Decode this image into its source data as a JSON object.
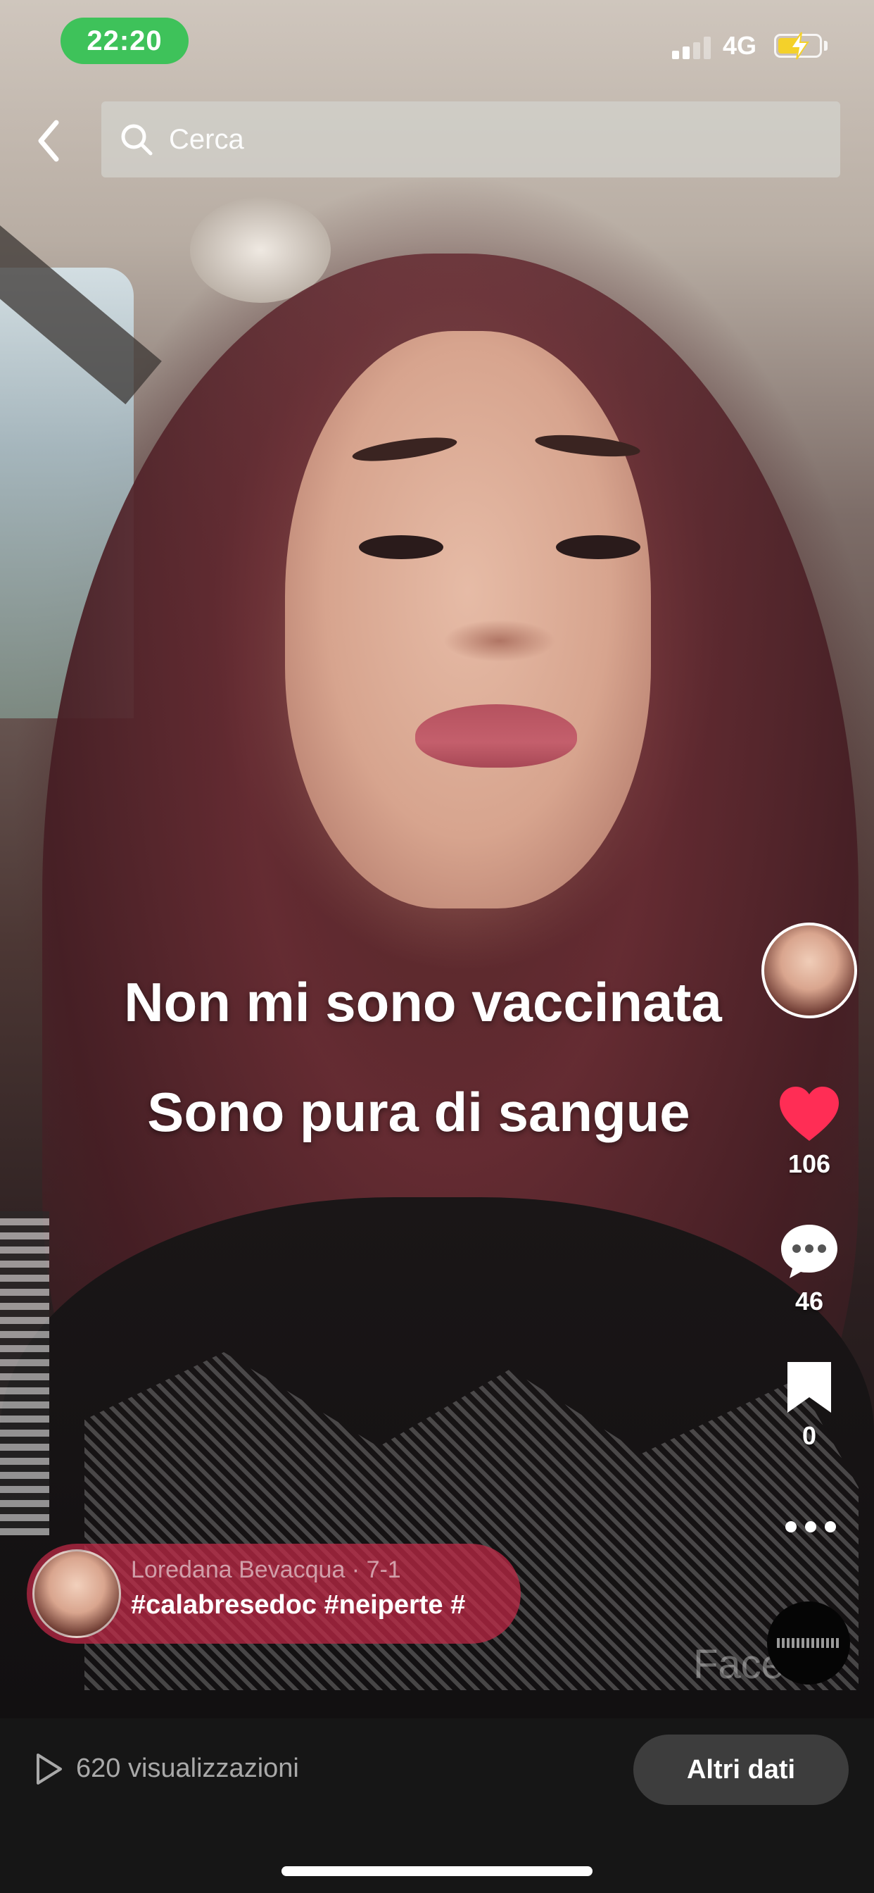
{
  "status_bar": {
    "time": "22:20",
    "network": "4G",
    "battery_level": 0.5,
    "signal_bars": 2,
    "time_pill_color": "#3ec25a",
    "battery_color": "#f4d12a"
  },
  "search": {
    "placeholder": "Cerca",
    "value": ""
  },
  "caption": {
    "line1": "Non mi sono vaccinata",
    "line2": "Sono pura di sangue"
  },
  "actions": {
    "likes": "106",
    "comments": "46",
    "saves": "0",
    "like_color": "#ff2d55"
  },
  "author": {
    "name": "Loredana Bevacqua · 7-1",
    "hashtags": "#calabresedoc #neiperte #",
    "pill_color": "#c42846"
  },
  "watermark": "Faceb",
  "bottom_bar": {
    "views": "620 visualizzazioni",
    "more_data_label": "Altri dati"
  },
  "icons": {
    "back": "chevron-left-icon",
    "search": "search-icon",
    "like": "heart-icon",
    "comment": "comment-bubble-icon",
    "save": "bookmark-icon",
    "more": "more-horizontal-icon",
    "views": "play-outline-icon"
  }
}
